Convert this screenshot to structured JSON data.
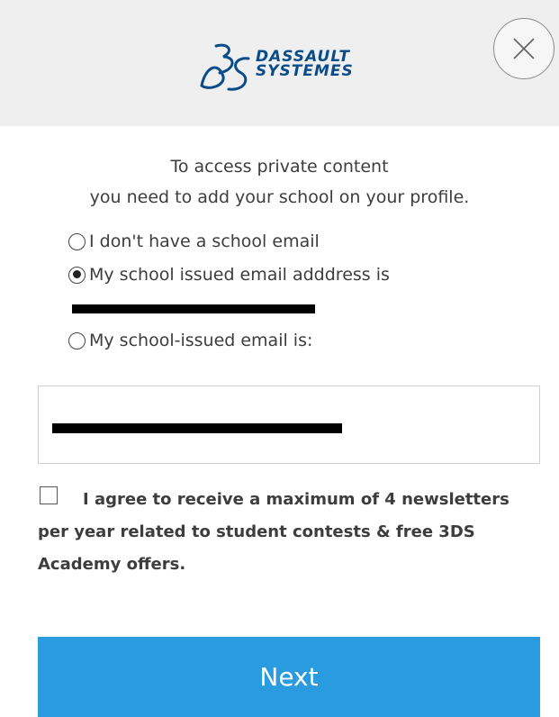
{
  "header": {
    "logo_line1": "DASSAULT",
    "logo_line2": "SYSTEMES",
    "brand_color": "#0a4c8a",
    "close_icon": "close-icon"
  },
  "intro": {
    "line1": "To access private content",
    "line2": "you need to add your school on your profile."
  },
  "options": [
    {
      "label": "I don't have a school email",
      "checked": false
    },
    {
      "label": "My school issued email adddress is",
      "checked": true
    },
    {
      "label": "My school-issued email is:",
      "checked": false
    }
  ],
  "email_input": {
    "value": ""
  },
  "consent": {
    "checked": false,
    "text": "I agree to receive a maximum of 4 newsletters per year related to student contests & free 3DS Academy offers."
  },
  "next_button": {
    "label": "Next",
    "color": "#2b9be0"
  }
}
